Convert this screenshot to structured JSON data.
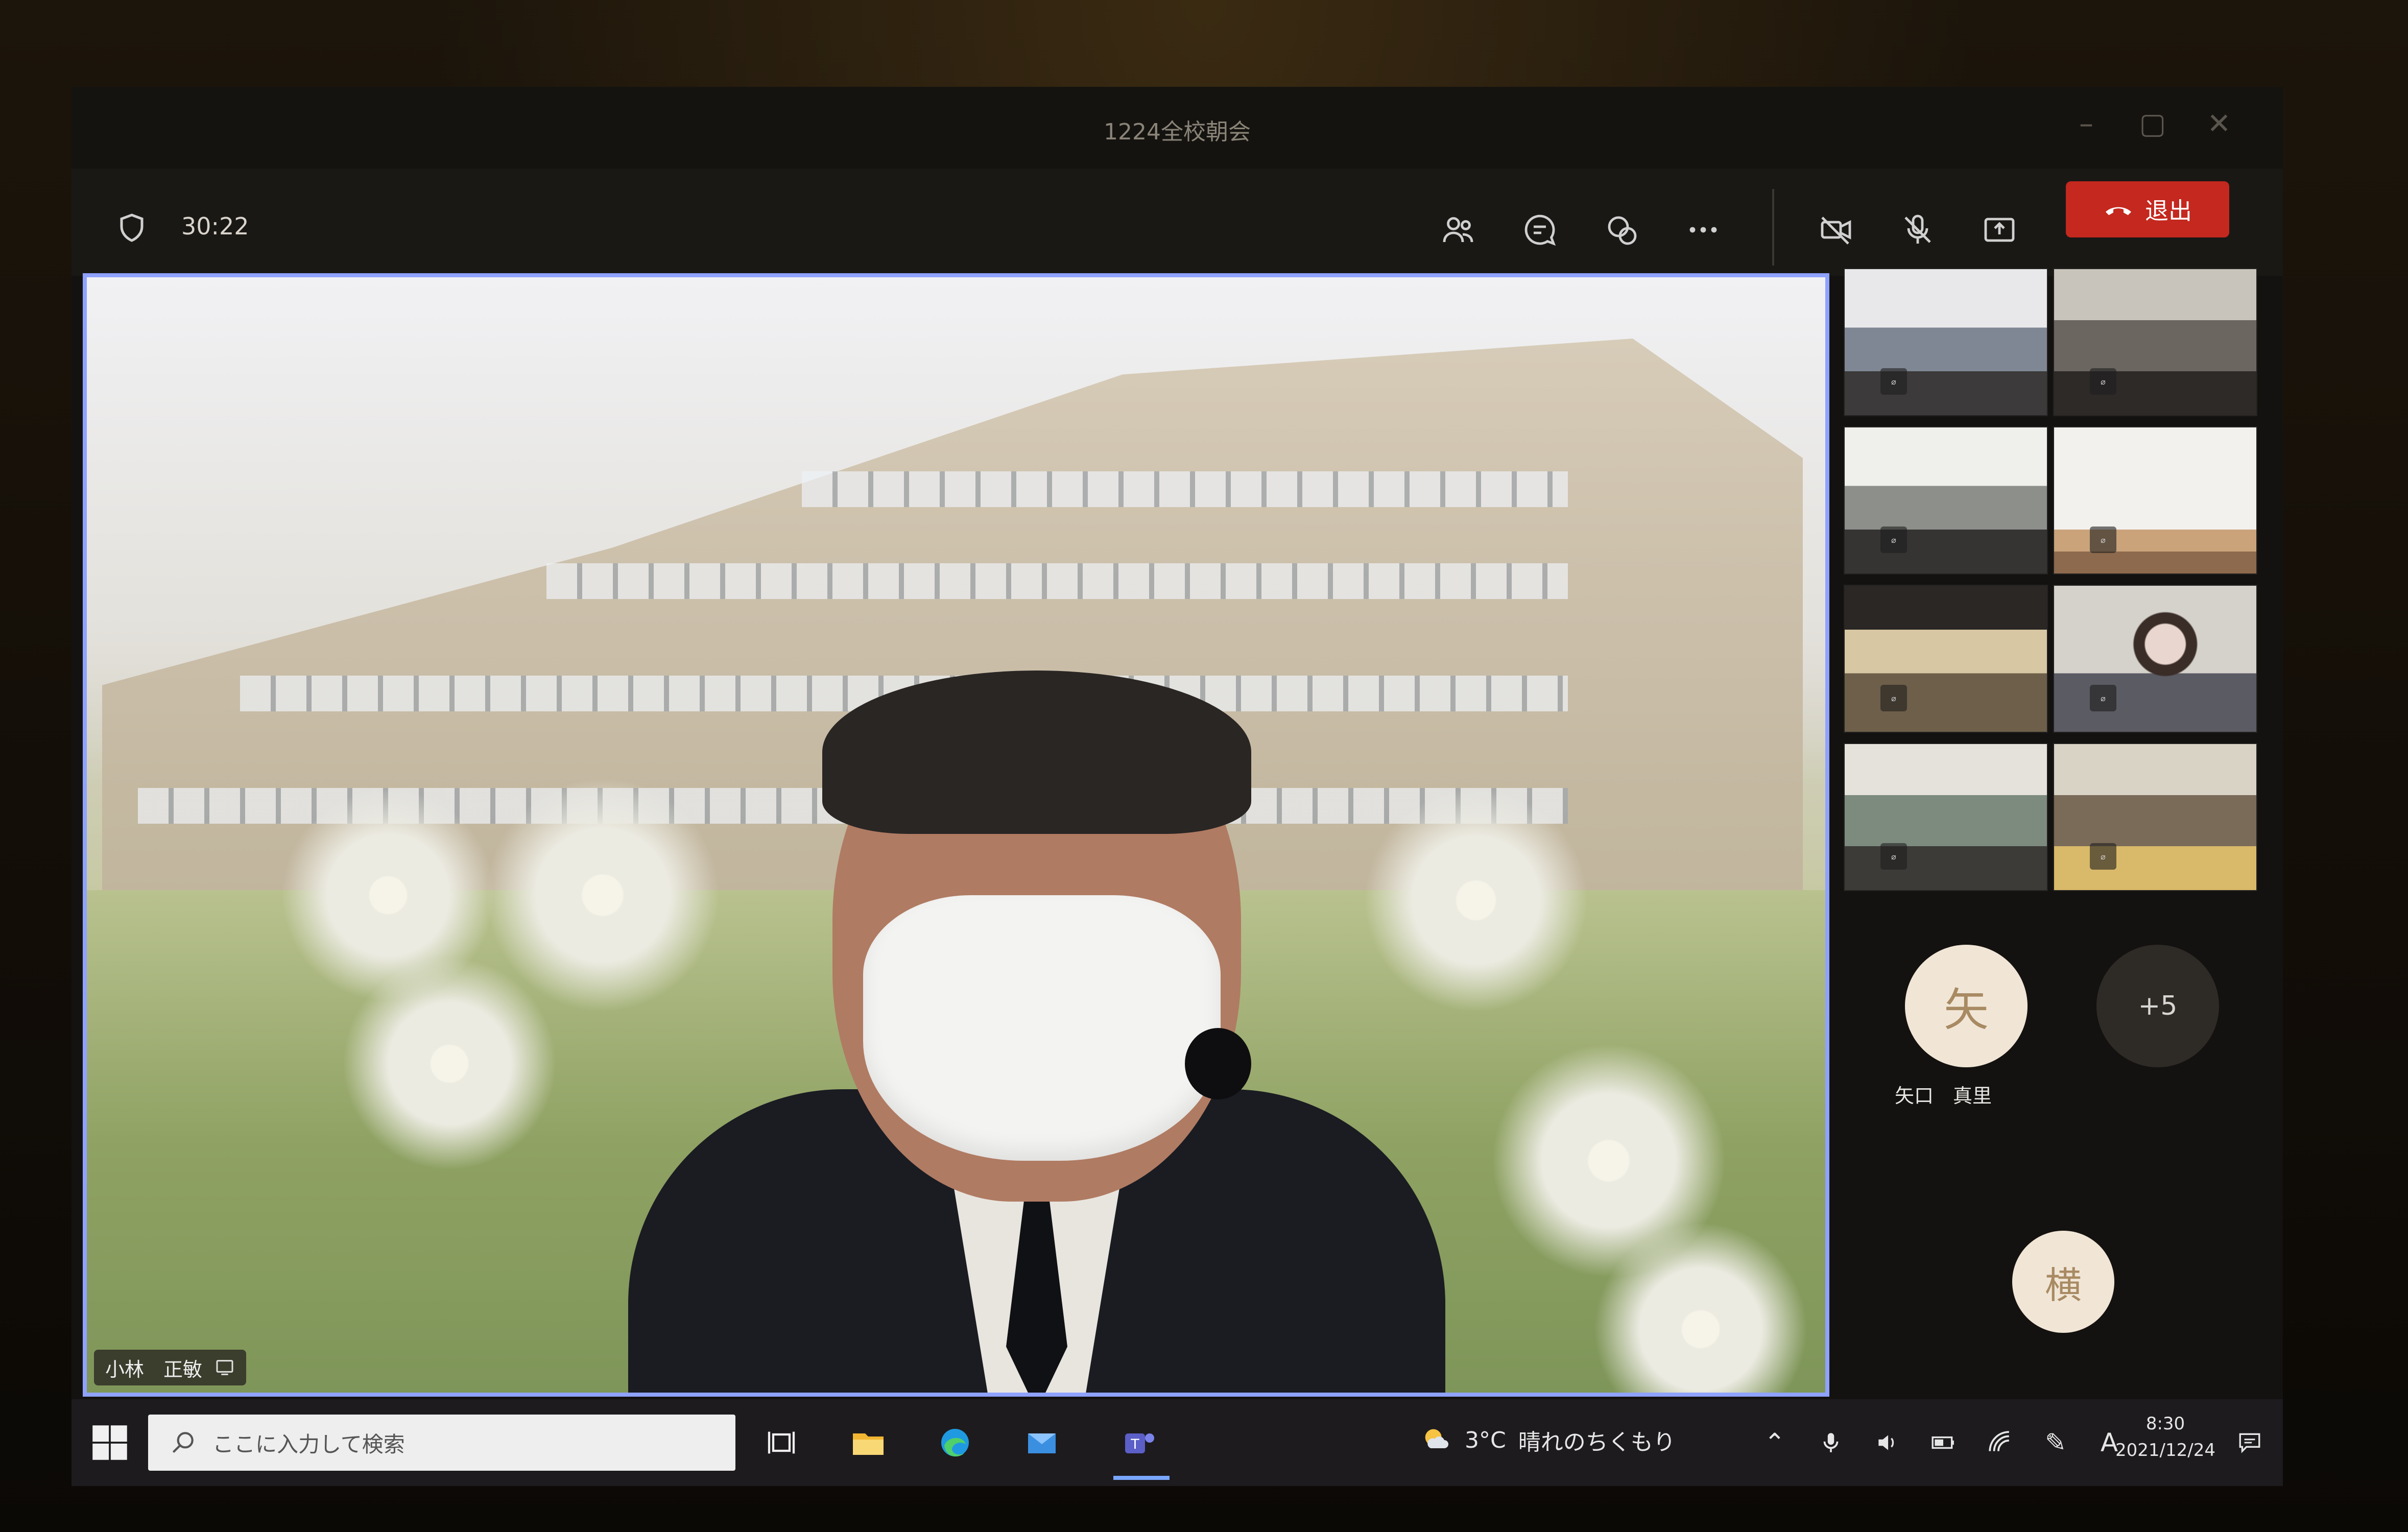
{
  "window": {
    "title": "1224全校朝会"
  },
  "meeting": {
    "elapsed": "30:22",
    "toolbar": {
      "participants_icon": "people-icon",
      "chat_icon": "chat-icon",
      "reactions_icon": "reactions-icon",
      "more_icon": "more-icon",
      "camera_icon": "camera-off-icon",
      "mic_icon": "mic-off-icon",
      "share_icon": "share-icon",
      "leave_label": "退出"
    },
    "presenter": {
      "name": "小林　正敏"
    },
    "avatars": [
      {
        "initial": "矢",
        "name": "矢口　真里"
      },
      {
        "initial": "+5",
        "name": ""
      },
      {
        "initial": "横",
        "name": ""
      }
    ]
  },
  "taskbar": {
    "search_placeholder": "ここに入力して検索",
    "weather": {
      "temp": "3°C",
      "condition": "晴れのちくもり"
    },
    "time": "8:30",
    "date": "2021/12/24",
    "ime": "A"
  },
  "colors": {
    "accent": "#8fa2ff",
    "leave": "#c4281e",
    "avatar_bg": "#f1e6d6",
    "avatar_fg": "#a88a63"
  }
}
